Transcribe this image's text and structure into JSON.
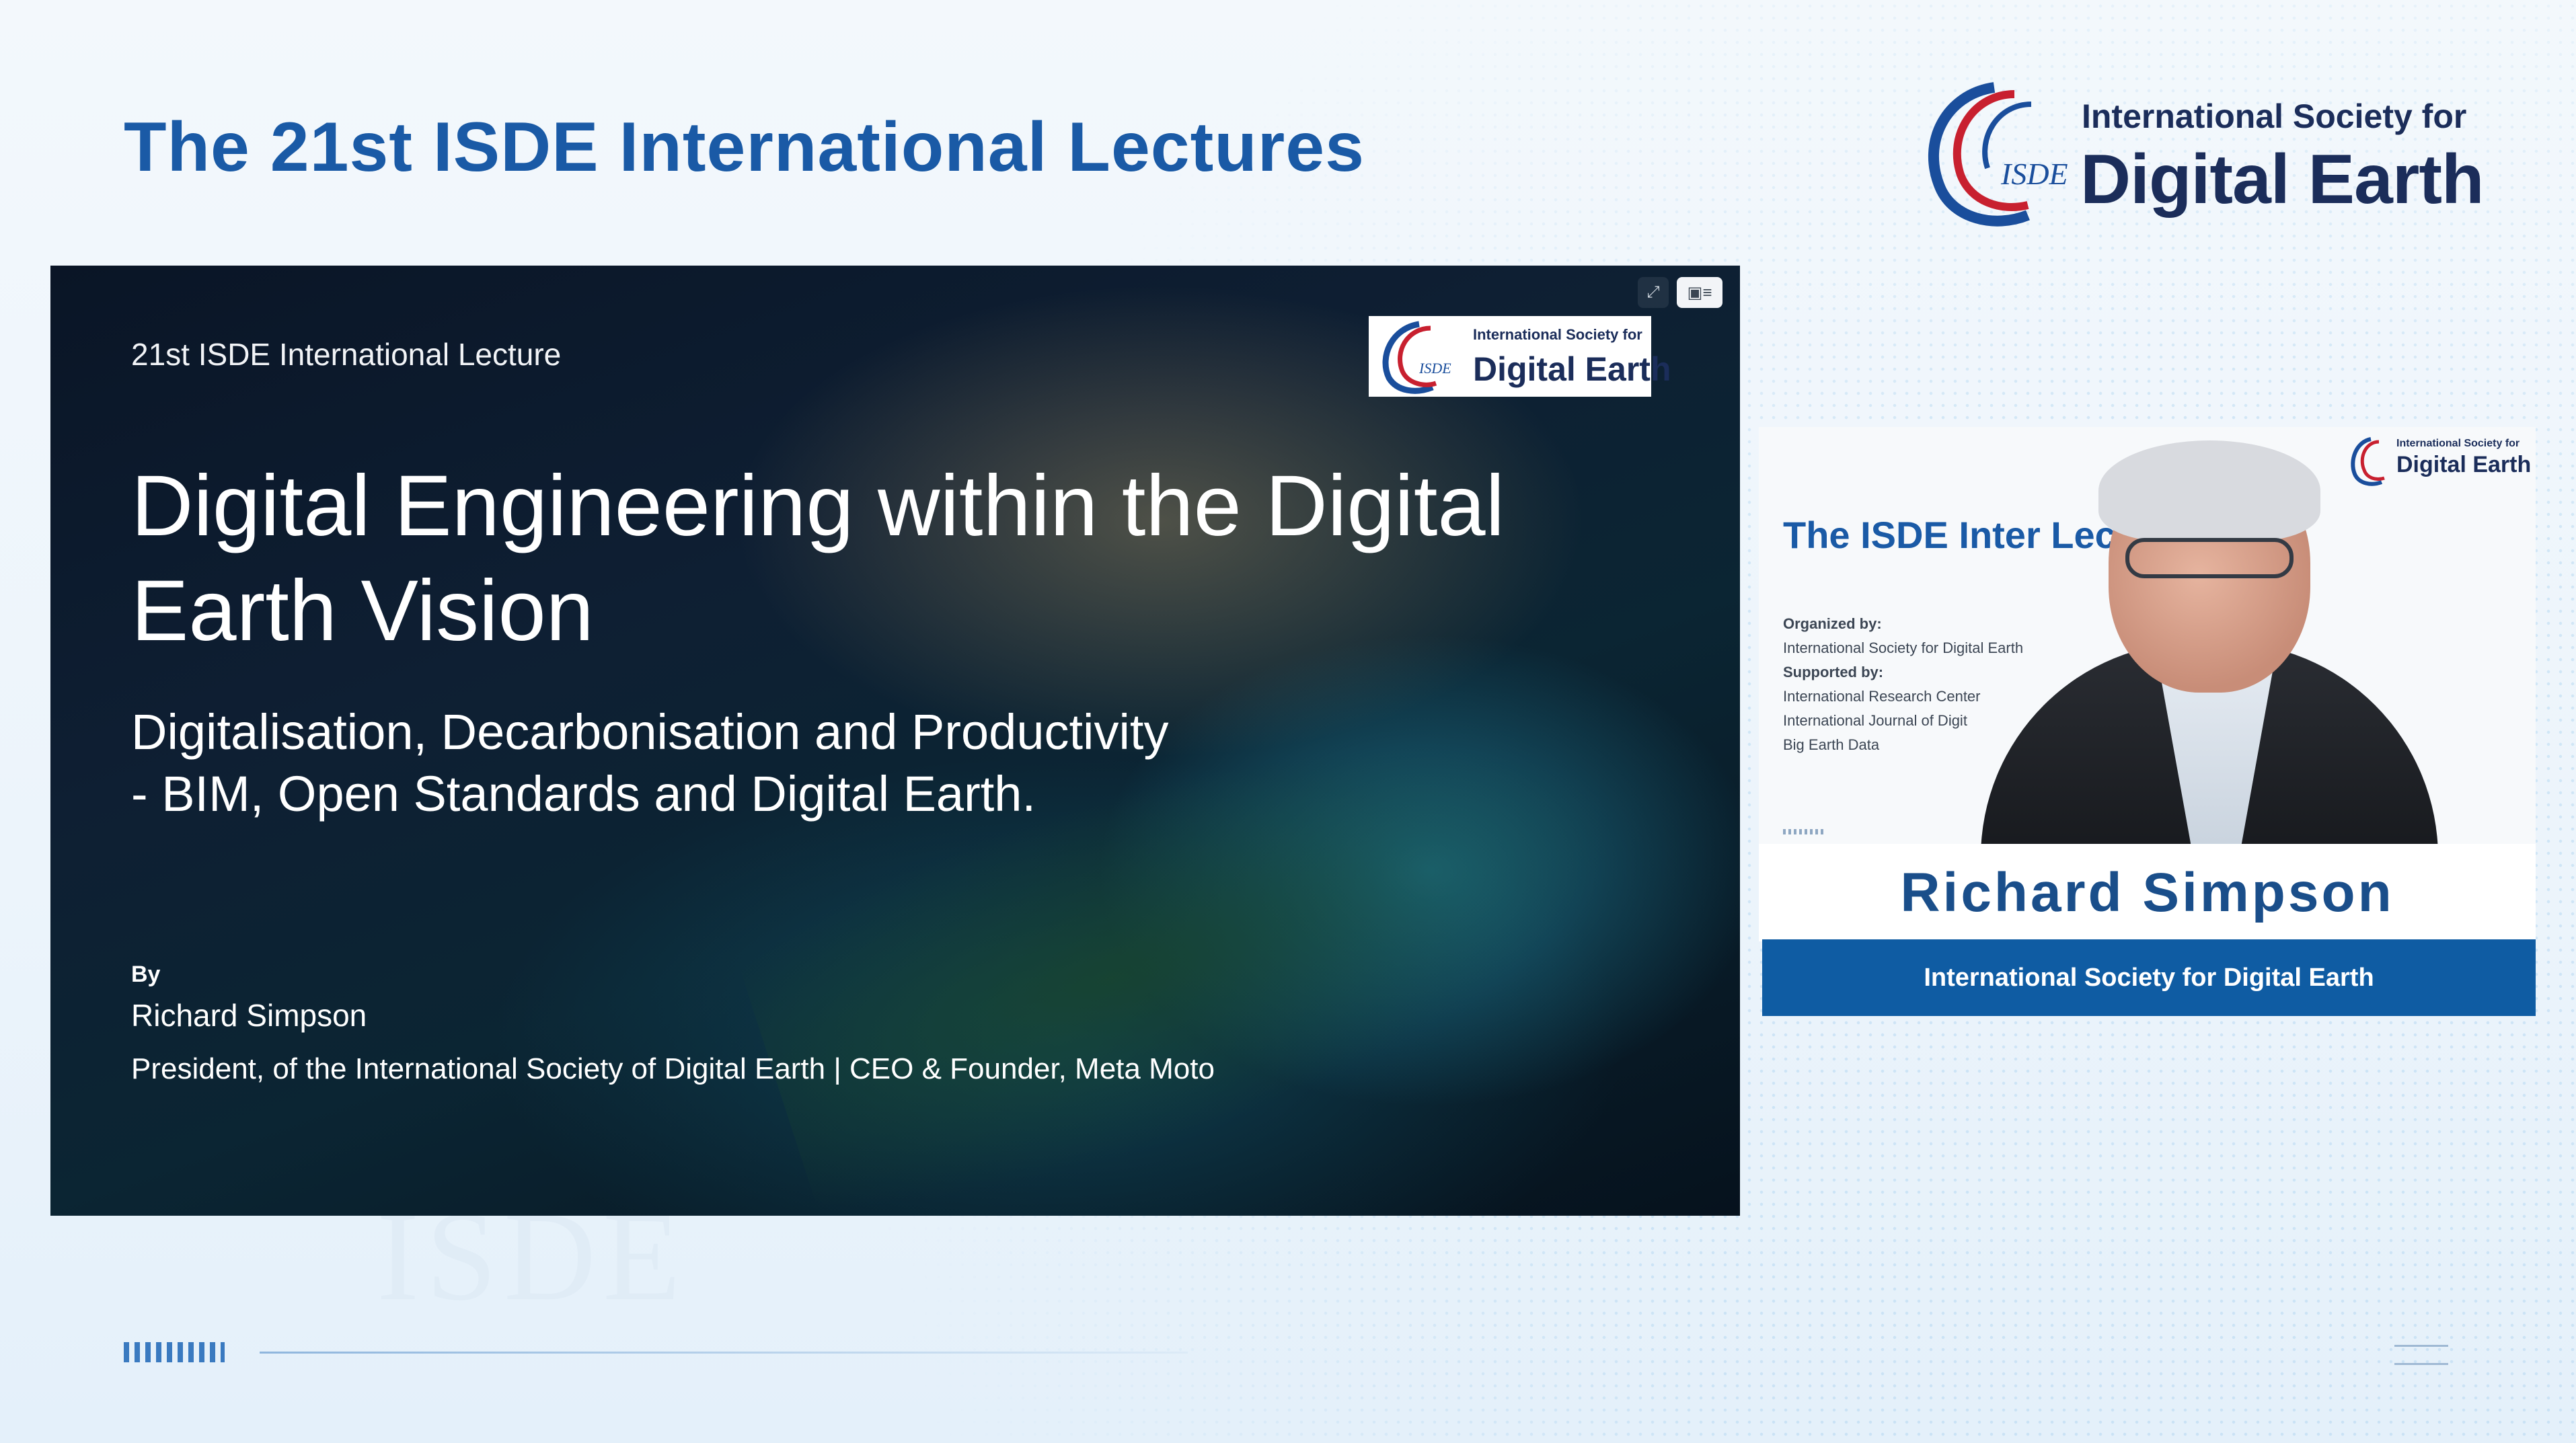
{
  "header": {
    "title": "The 21st ISDE International Lectures"
  },
  "brand": {
    "mark": "ISDE",
    "line1": "International Society for",
    "line2": "Digital Earth",
    "colors": {
      "blue": "#1a5aa6",
      "navy": "#1b2d5a",
      "red": "#c8202f"
    }
  },
  "slide": {
    "kicker": "21st ISDE International Lecture",
    "title": "Digital Engineering within the Digital Earth Vision",
    "subtitle": "Digitalisation, Decarbonisation and Productivity\n- BIM, Open Standards and Digital  Earth.",
    "by_label": "By",
    "presenter_name": "Richard Simpson",
    "presenter_role": "President, of the International Society of Digital Earth | CEO & Founder, Meta Moto",
    "logo": {
      "mark": "ISDE",
      "line1": "International Society for",
      "line2": "Digital Earth"
    },
    "controls": {
      "expand_icon": "expand-icon",
      "layout_icon": "layout-toggle-icon"
    }
  },
  "speaker_panel": {
    "background_title": "The ISDE Inter          Lectures",
    "organized_by_label": "Organized by:",
    "organized_by": "International Society for Digital Earth",
    "supported_by_label": "Supported by:",
    "supporters": [
      "International Research Center",
      "International Journal of Digit",
      "Big Earth Data"
    ],
    "mini_logo": {
      "line1": "International Society for",
      "line2": "Digital Earth"
    }
  },
  "name_card": {
    "speaker_name": "Richard Simpson",
    "affiliation": "International Society for Digital Earth"
  }
}
